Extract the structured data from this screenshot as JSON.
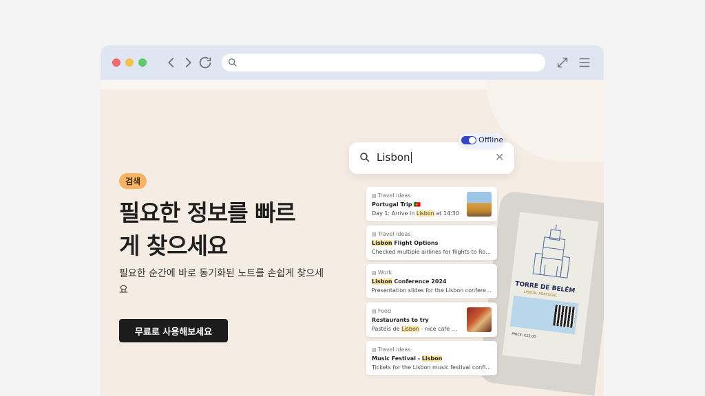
{
  "browser": {
    "url_value": "",
    "icons": [
      "back-icon",
      "forward-icon",
      "reload-icon",
      "search-icon",
      "expand-icon",
      "menu-icon"
    ]
  },
  "hero": {
    "badge": "검색",
    "headline_line1": "필요한 정보를 빠르",
    "headline_line2": "게 찾으세요",
    "subtitle": "필요한 순간에 바로 동기화된 노트를 손쉽게 찾으세요",
    "cta_label": "무료로 사용해보세요"
  },
  "search": {
    "query": "Lisbon",
    "offline_label": "Offline",
    "offline_enabled": true
  },
  "results": [
    {
      "category": "Travel ideas",
      "title": "Portugal Trip 🇵🇹",
      "desc_pre": "Day 1: Arrive in ",
      "desc_hl": "Lisbon",
      "desc_post": " at 14:30"
    },
    {
      "category": "Travel ideas",
      "title_hl": "Lisbon",
      "title_post": " Flight Options",
      "desc": "Checked multiple airlines for flights to Rome..."
    },
    {
      "category": "Work",
      "title_hl": "Lisbon",
      "title_post": " Conference 2024",
      "desc": "Presentation slides for the Lisbon conferenc..."
    },
    {
      "category": "Food",
      "title": "Restaurants to try",
      "desc_pre": "Pastéis de ",
      "desc_hl": "Lisbon",
      "desc_post": " - nice cafe cl..."
    },
    {
      "category": "Travel ideas",
      "title_pre": "Music Festival - ",
      "title_hl": "Lisbon",
      "desc": "Tickets for the Lisbon music festival confirm..."
    }
  ],
  "ticket": {
    "title": "TORRE DE BELÉM",
    "subtitle": "LISBON, PORTUGAL",
    "price": "PRICE: €12.00"
  },
  "colors": {
    "page_bg": "#f5ede3",
    "chrome_bg": "#dfe6f1",
    "badge_bg": "#f6b364",
    "cta_bg": "#1c1c1c",
    "toggle_on": "#3446c4",
    "highlight": "#fbe7a0"
  }
}
